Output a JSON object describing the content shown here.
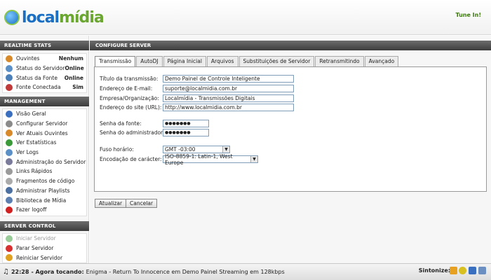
{
  "header": {
    "logo_local": "local",
    "logo_midia": "mídia",
    "tunein": "Tune In!"
  },
  "sidebar": {
    "realtime": {
      "title": "REALTIME STATS",
      "items": [
        {
          "label": "Ouvintes",
          "value": "Nenhum",
          "icon": "listeners-icon",
          "color": "#d88a2a"
        },
        {
          "label": "Status do Servidor",
          "value": "Online",
          "icon": "server-status-icon",
          "color": "#5a8fc8"
        },
        {
          "label": "Status da Fonte",
          "value": "Online",
          "icon": "source-status-icon",
          "color": "#4a7fb8"
        },
        {
          "label": "Fonte Conectada",
          "value": "Sim",
          "icon": "source-connected-icon",
          "color": "#c03a3a"
        }
      ]
    },
    "management": {
      "title": "MANAGEMENT",
      "items": [
        {
          "label": "Visão Geral",
          "icon": "overview-icon",
          "color": "#3a6fc0"
        },
        {
          "label": "Configurar Servidor",
          "icon": "configure-server-icon",
          "color": "#8a8a8a"
        },
        {
          "label": "Ver Atuais Ouvintes",
          "icon": "current-listeners-icon",
          "color": "#d88a2a"
        },
        {
          "label": "Ver Estatísticas",
          "icon": "statistics-icon",
          "color": "#3a9a3a"
        },
        {
          "label": "Ver Logs",
          "icon": "logs-icon",
          "color": "#5a8fc8"
        },
        {
          "label": "Administração do Servidor",
          "icon": "server-admin-icon",
          "color": "#7a7a9a"
        },
        {
          "label": "Links Rápidos",
          "icon": "quick-links-icon",
          "color": "#9a9a9a"
        },
        {
          "label": "Fragmentos de código",
          "icon": "code-snippets-icon",
          "color": "#aaaaaa"
        },
        {
          "label": "Administrar Playlists",
          "icon": "playlists-icon",
          "color": "#4a6fa0"
        },
        {
          "label": "Biblioteca de Mídia",
          "icon": "media-library-icon",
          "color": "#5a7fb0"
        },
        {
          "label": "Fazer logoff",
          "icon": "logoff-icon",
          "color": "#d02020"
        }
      ]
    },
    "control": {
      "title": "SERVER CONTROL",
      "items": [
        {
          "label": "Iniciar Servidor",
          "icon": "start-server-icon",
          "color": "#9acc9a",
          "disabled": true
        },
        {
          "label": "Parar Servidor",
          "icon": "stop-server-icon",
          "color": "#d83030"
        },
        {
          "label": "Reiniciar Servidor",
          "icon": "restart-server-icon",
          "color": "#e0a020"
        }
      ]
    }
  },
  "main": {
    "title": "CONFIGURE SERVER",
    "tabs": [
      "Transmissão",
      "AutoDJ",
      "Página Inicial",
      "Arquivos",
      "Substituições de Servidor",
      "Retransmitindo",
      "Avançado"
    ],
    "form": {
      "titulo": {
        "label": "Título da transmissão:",
        "value": "Demo Painel de Controle Inteligente"
      },
      "email": {
        "label": "Endereço de E-mail:",
        "value": "suporte@localmidia.com.br"
      },
      "empresa": {
        "label": "Empresa/Organização:",
        "value": "Localmídia - Transmissões Digitais"
      },
      "site": {
        "label": "Endereço do site (URL):",
        "value": "http://www.localmidia.com.br"
      },
      "senha_fonte": {
        "label": "Senha da fonte:",
        "value": "●●●●●●●"
      },
      "senha_admin": {
        "label": "Senha do administrador:",
        "value": "●●●●●●●"
      },
      "fuso": {
        "label": "Fuso horário:",
        "value": "GMT -03:00"
      },
      "encoding": {
        "label": "Encodação de carácter:",
        "value": "ISO-8859-1: Latin-1, West Europe"
      }
    },
    "buttons": {
      "update": "Atualizar",
      "cancel": "Cancelar"
    }
  },
  "footer": {
    "time": "22:28",
    "now_playing_label": "- Agora tocando:",
    "now_playing": "Enigma - Return To Innocence em Demo Painel Streaming em 128kbps",
    "tune": "Sintonize:"
  }
}
